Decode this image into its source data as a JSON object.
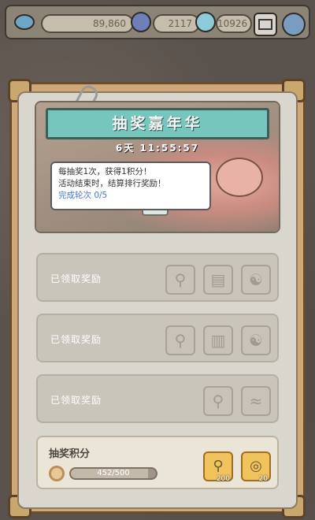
{
  "topbar": {
    "coin_value": "89,860",
    "energy_value": "2117",
    "gem_value": "10926"
  },
  "event": {
    "title": "抽奖嘉年华",
    "timer": "6天 11:55:57",
    "desc_line1": "每抽奖1次，获得1积分！",
    "desc_line2": "活动结束时，结算排行奖励！",
    "progress_label": "完成轮次 0/5"
  },
  "rewards": [
    {
      "label": "已领取奖励",
      "items": [
        "tennis-racket",
        "ticket",
        "yin-yang"
      ]
    },
    {
      "label": "已领取奖励",
      "items": [
        "tennis-racket",
        "scroll",
        "yin-yang"
      ]
    },
    {
      "label": "已领取奖励",
      "items": [
        "tennis-racket",
        "fish-lure"
      ]
    }
  ],
  "score": {
    "title": "抽奖积分",
    "progress_text": "452/500",
    "progress_fraction": 0.904,
    "items": [
      {
        "icon": "tennis-racket",
        "count": "200"
      },
      {
        "icon": "coin-stack",
        "count": "20"
      }
    ]
  },
  "colors": {
    "ribbon": "#77c6bd",
    "frame": "#cfa877",
    "gold_slot": "#f0c35c"
  }
}
